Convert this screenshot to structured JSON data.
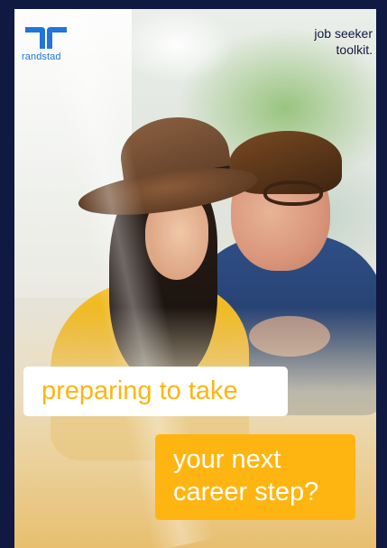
{
  "brand": {
    "logo_text": "randstad",
    "logo_color": "#2175d9"
  },
  "header": {
    "toolkit_line1": "job seeker",
    "toolkit_line2": "toolkit."
  },
  "headline": {
    "line1": "preparing to take",
    "line2": "your next",
    "line3": "career step?"
  },
  "colors": {
    "frame": "#0f1941",
    "accent_yellow": "#ffb511",
    "white": "#ffffff"
  },
  "icons": [
    "randstad-logo-icon"
  ]
}
